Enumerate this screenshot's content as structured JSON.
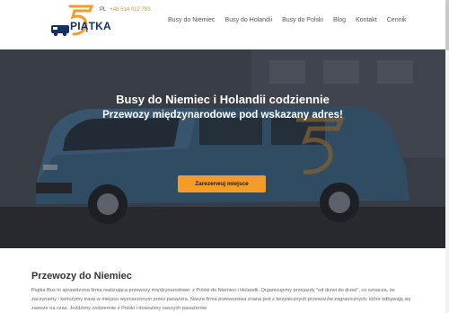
{
  "header": {
    "phone_prefix": "PL",
    "phone_number": "+48 514 012 793",
    "brand_name": "PIĄTKA"
  },
  "nav": {
    "items": [
      {
        "label": "Busy do Niemiec"
      },
      {
        "label": "Busy do Holandii"
      },
      {
        "label": "Busy do Polski"
      },
      {
        "label": "Blog"
      },
      {
        "label": "Kontakt"
      },
      {
        "label": "Cennik"
      }
    ]
  },
  "hero": {
    "title": "Busy do Niemiec i Holandii codziennie",
    "subtitle": "Przewozy międzynarodowe pod wskazany adres!",
    "cta_label": "Zarezerwuj miejsce"
  },
  "content": {
    "title": "Przewozy do Niemiec",
    "paragraph": "Piątka Bus to sprawdzona firma realizująca przewozy międzynarodowe: z Polski do Niemiec i Holandii. Organizujemy przejazdy \"od drzwi do drzwi\", co oznacza, że zaczynamy i kończymy trasę w miejscu wyznaczonym przez pasażera. Nasza firma przewozowa znana jest z bezpiecznych przewozów zagranicznych, które odbywają się zawsze na czas. Jeździmy codziennie z Polski i dowozimy naszych pasażerów"
  },
  "colors": {
    "accent": "#f39c2b",
    "brand_navy": "#13325f",
    "van_blue": "#3e6d8c"
  }
}
